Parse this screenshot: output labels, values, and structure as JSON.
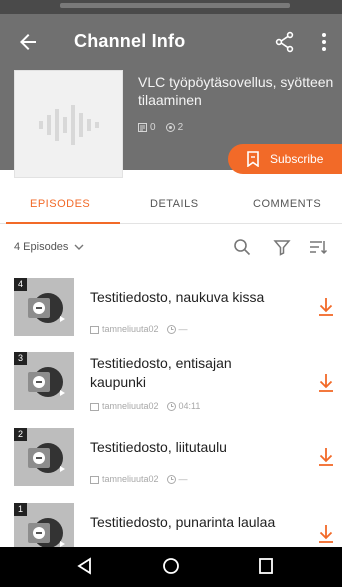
{
  "toolbar": {
    "title": "Channel Info",
    "icons": {
      "back": "arrow-back-icon",
      "share": "share-icon",
      "more": "more-vert-icon"
    }
  },
  "channel": {
    "name": "VLC työpöytäsovellus, syötteen tilaaminen",
    "episode_count": "0",
    "subscriber_count": "2",
    "cover_icon": "audio-waveform-icon"
  },
  "subscribe": {
    "label": "Subscribe",
    "icon": "bookmark-icon"
  },
  "tabs": [
    {
      "label": "EPISODES",
      "active": true
    },
    {
      "label": "DETAILS",
      "active": false
    },
    {
      "label": "COMMENTS",
      "active": false
    }
  ],
  "filterbar": {
    "count_label": "4 Episodes",
    "icons": [
      "search-icon",
      "filter-icon",
      "sort-icon"
    ]
  },
  "episodes": [
    {
      "number": "4",
      "title": "Testitiedosto, naukuva kissa",
      "author": "tamneliuuta02",
      "duration": "—"
    },
    {
      "number": "3",
      "title": "Testitiedosto, entisajan kaupunki",
      "author": "tamneliuuta02",
      "duration": "04:11"
    },
    {
      "number": "2",
      "title": "Testitiedosto, liitutaulu",
      "author": "tamneliuuta02",
      "duration": "—"
    },
    {
      "number": "1",
      "title": "Testitiedosto, punarinta laulaa",
      "author": "",
      "duration": ""
    }
  ],
  "colors": {
    "accent": "#f26a28",
    "header": "#707070",
    "navbar": "#000000"
  }
}
